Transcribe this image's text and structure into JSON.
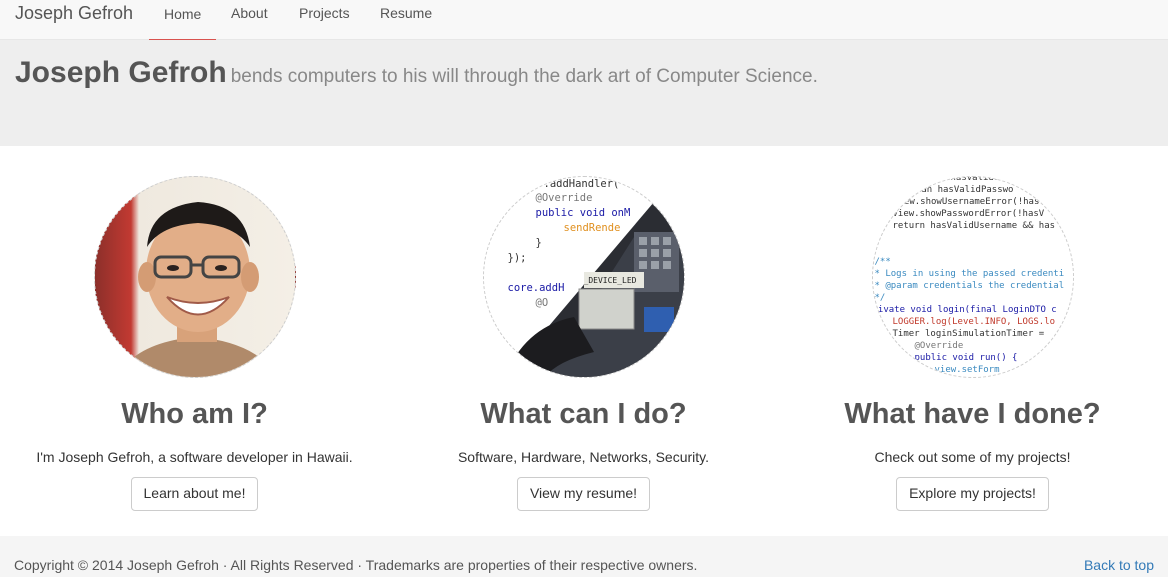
{
  "navbar": {
    "brand": "Joseph Gefroh",
    "items": [
      {
        "label": "Home",
        "active": true
      },
      {
        "label": "About",
        "active": false
      },
      {
        "label": "Projects",
        "active": false
      },
      {
        "label": "Resume",
        "active": false
      }
    ],
    "active_color": "#d9534f"
  },
  "hero": {
    "name": "Joseph Gefroh",
    "tagline": "bends computers to his will through the dark art of Computer Science."
  },
  "columns": [
    {
      "title": "Who am I?",
      "text": "I'm Joseph Gefroh, a software developer in Hawaii.",
      "button": "Learn about me!"
    },
    {
      "title": "What can I do?",
      "text": "Software, Hardware, Networks, Security.",
      "button": "View my resume!"
    },
    {
      "title": "What have I done?",
      "text": "Check out some of my projects!",
      "button": "Explore my projects!"
    }
  ],
  "images": {
    "code1": {
      "lines": [
        ".addHandler(",
        "@Override",
        "public void onM",
        "sendRende",
        "}",
        "});",
        "core.addH",
        "@O"
      ],
      "chip_label": "_DEVICE_LED"
    },
    "code2": {
      "lines": [
        "hasValidUse",
        "lean hasValidPasswo",
        "iew.showUsernameError(!has",
        "view.showPasswordError(!hasV",
        "return hasValidUsername && has",
        "/**",
        "* Logs in using the passed credenti",
        "* @param credentials the credential",
        "*/",
        "rivate void login(final LoginDTO c",
        "LOGGER.log(Level.INFO, LOGS.lo",
        "Timer loginSimulationTimer =",
        "@Override",
        "public void run() {",
        "view.setForm"
      ]
    }
  },
  "footer": {
    "copyright": "Copyright © 2014 Joseph Gefroh · All Rights Reserved · Trademarks are properties of their respective owners.",
    "back_to_top": "Back to top",
    "link_color": "#337ab7"
  }
}
